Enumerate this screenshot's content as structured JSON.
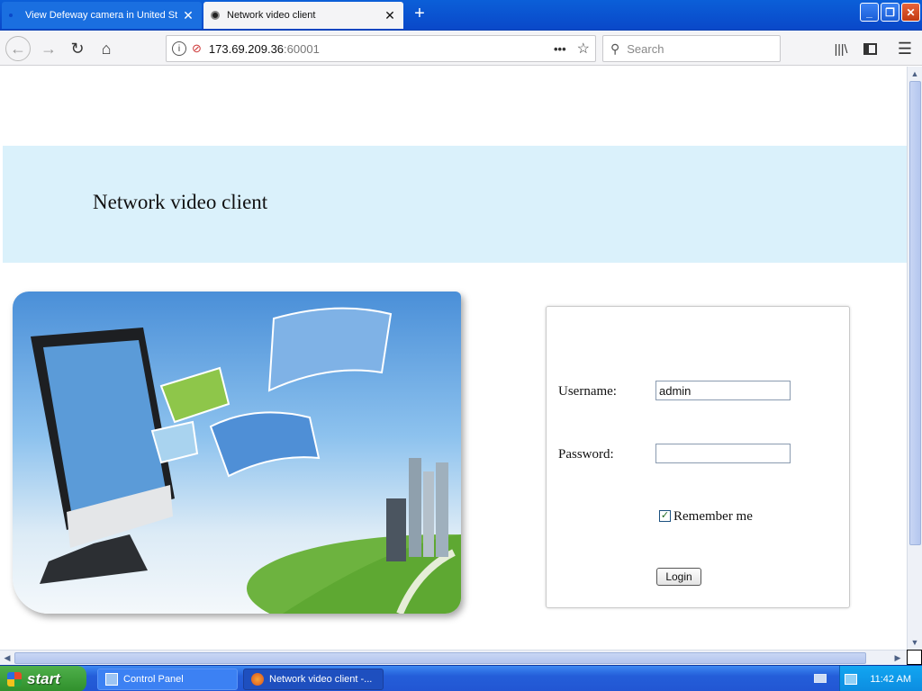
{
  "browser": {
    "tabs": [
      {
        "title": "View Defeway camera in United St"
      },
      {
        "title": "Network video client"
      }
    ],
    "url": {
      "host": "173.69.209.36",
      "port": ":60001"
    },
    "search_placeholder": "Search",
    "new_tab_symbol": "+"
  },
  "page": {
    "banner_title": "Network video client",
    "banner_color": "#daf1fb",
    "login": {
      "username_label": "Username:",
      "username_value": "admin",
      "password_label": "Password:",
      "password_value": "",
      "remember_label": "Remember me",
      "remember_checked": true,
      "login_button": "Login"
    }
  },
  "taskbar": {
    "start_label": "start",
    "items": [
      {
        "label": "Control Panel"
      },
      {
        "label": "Network video client -..."
      }
    ],
    "clock": "11:42 AM"
  }
}
